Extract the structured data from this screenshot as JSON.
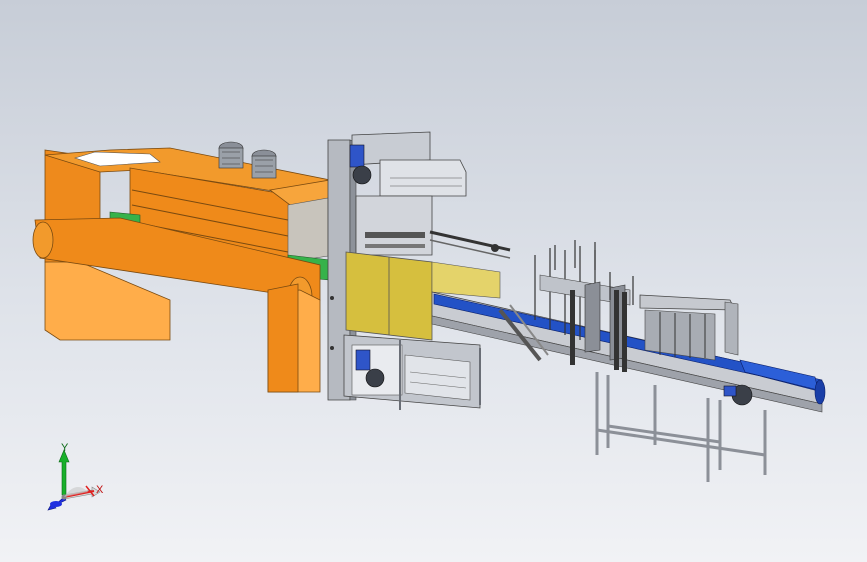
{
  "triad": {
    "y_label": "Y",
    "x_label": "X"
  },
  "colors": {
    "background_top": "#c7cdd7",
    "background_bottom": "#f1f2f5",
    "orange": "#f08a18",
    "light_orange": "#ffad4a",
    "green": "#3ab44a",
    "yellow": "#d8c244",
    "blue_belt": "#2050c0",
    "steel": "#b9bdc4",
    "axis_y": "#18b02a",
    "axis_x": "#e02020",
    "axis_z": "#2030e0"
  }
}
